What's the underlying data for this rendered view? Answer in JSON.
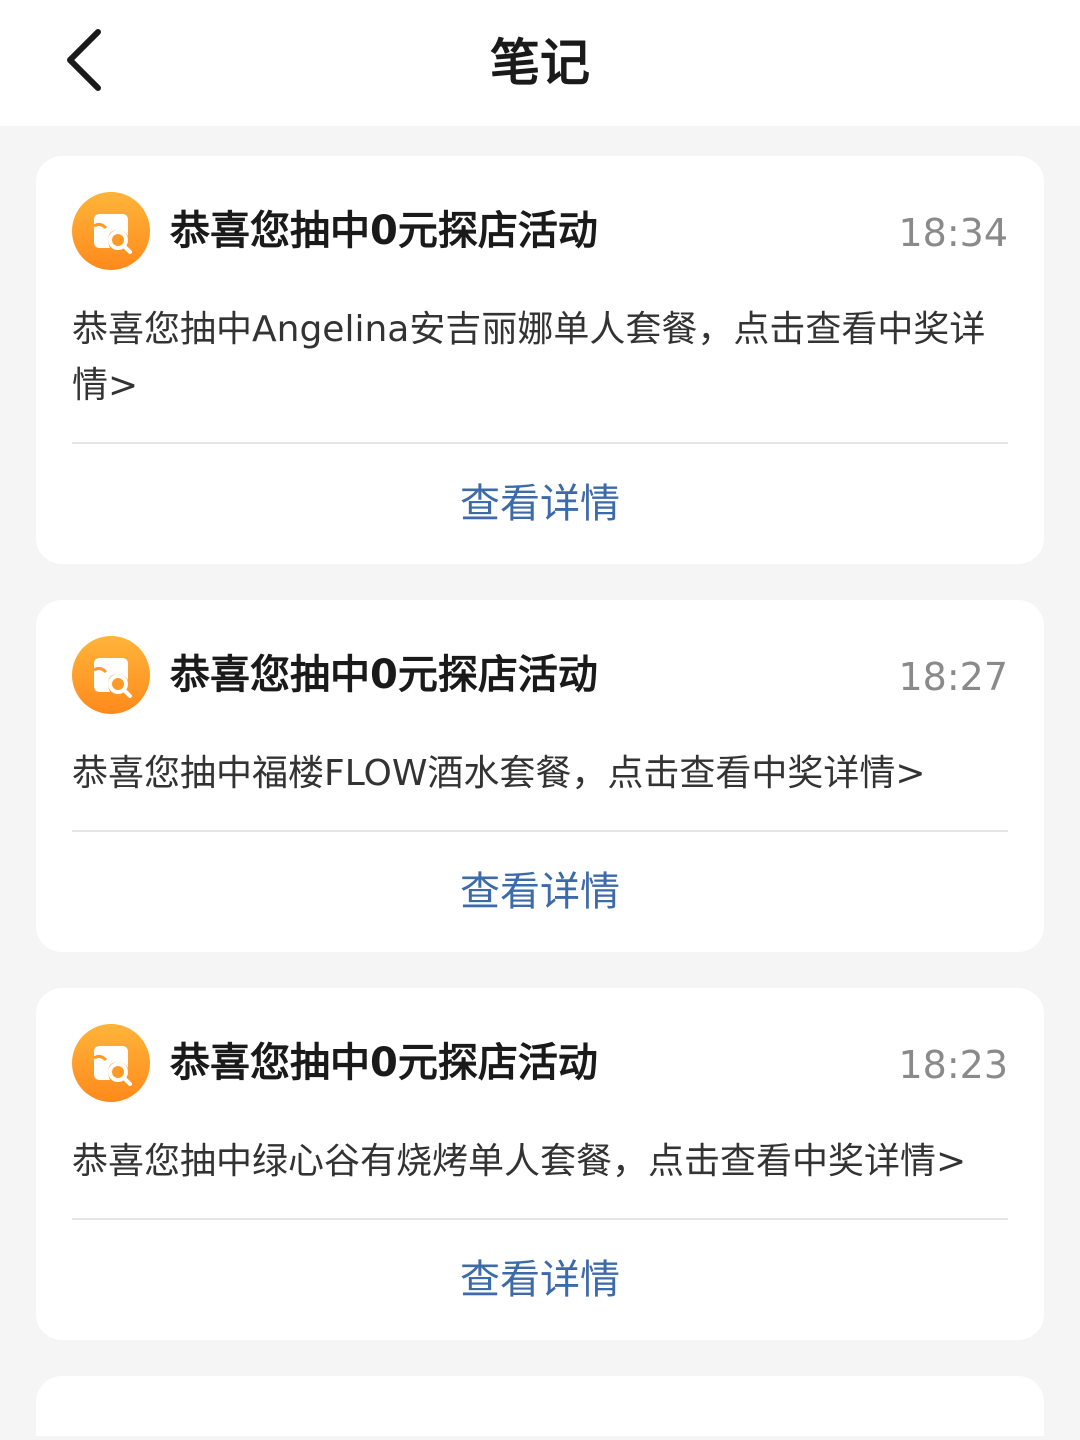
{
  "header": {
    "title": "笔记",
    "back_icon": "chevron-left-icon"
  },
  "notifications": [
    {
      "icon": "shop-search-icon",
      "title": "恭喜您抽中0元探店活动",
      "time": "18:34",
      "body": "恭喜您抽中Angelina安吉丽娜单人套餐，点击查看中奖详情>",
      "action_label": "查看详情"
    },
    {
      "icon": "shop-search-icon",
      "title": "恭喜您抽中0元探店活动",
      "time": "18:27",
      "body": "恭喜您抽中福楼FLOW酒水套餐，点击查看中奖详情>",
      "action_label": "查看详情"
    },
    {
      "icon": "shop-search-icon",
      "title": "恭喜您抽中0元探店活动",
      "time": "18:23",
      "body": "恭喜您抽中绿心谷有烧烤单人套餐，点击查看中奖详情>",
      "action_label": "查看详情"
    }
  ],
  "colors": {
    "accent_link": "#3d6aa8",
    "icon_orange": "#ff9a26",
    "background": "#f5f5f5"
  }
}
